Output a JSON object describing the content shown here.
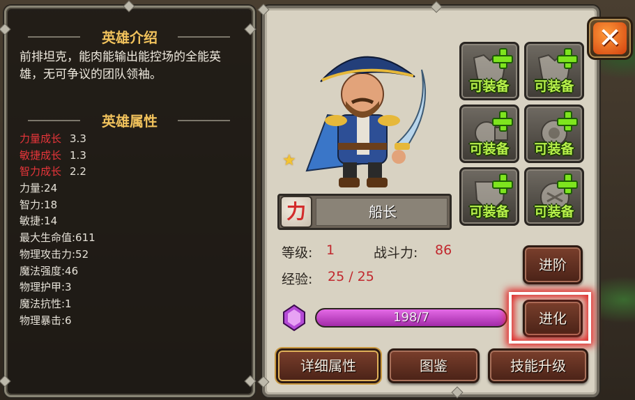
{
  "left_panel": {
    "intro_title": "英雄介绍",
    "intro_text": "前排坦克，能肉能输出能控场的全能英雄，无可争议的团队领袖。",
    "attr_title": "英雄属性",
    "growth": [
      {
        "label": "力量成长",
        "value": "3.3"
      },
      {
        "label": "敏捷成长",
        "value": "1.3"
      },
      {
        "label": "智力成长",
        "value": "2.2"
      }
    ],
    "stats": [
      "力量:24",
      "智力:18",
      "敏捷:14",
      "最大生命值:611",
      "物理攻击力:52",
      "魔法强度:46",
      "物理护甲:3",
      "魔法抗性:1",
      "物理暴击:6"
    ]
  },
  "hero": {
    "name": "船长",
    "type_badge": "力",
    "stars": 1,
    "star_glyph": "★",
    "level_label": "等级:",
    "level": "1",
    "power_label": "战斗力:",
    "power": "86",
    "exp_label": "经验:",
    "exp": "25 / 25",
    "soul_progress": "198/7",
    "soul_fill_fraction": 1.0
  },
  "equipment": [
    {
      "label": "可装备",
      "icon": "chest-armor-icon"
    },
    {
      "label": "可装备",
      "icon": "chest-armor-icon"
    },
    {
      "label": "可装备",
      "icon": "gauntlet-icon"
    },
    {
      "label": "可装备",
      "icon": "gauntlet-icon"
    },
    {
      "label": "可装备",
      "icon": "shield-icon"
    },
    {
      "label": "可装备",
      "icon": "shield-icon"
    }
  ],
  "buttons": {
    "advance": "进阶",
    "evolve": "进化",
    "details": "详细属性",
    "atlas": "图鉴",
    "skill_upgrade": "技能升级",
    "close": "✕"
  },
  "colors": {
    "title_gold": "#f1c25c",
    "growth_red": "#e8353a",
    "equip_green": "#b7f04a",
    "value_red": "#c1272d",
    "soul_bar": "#c040c6",
    "highlight": "#e12a2a"
  }
}
